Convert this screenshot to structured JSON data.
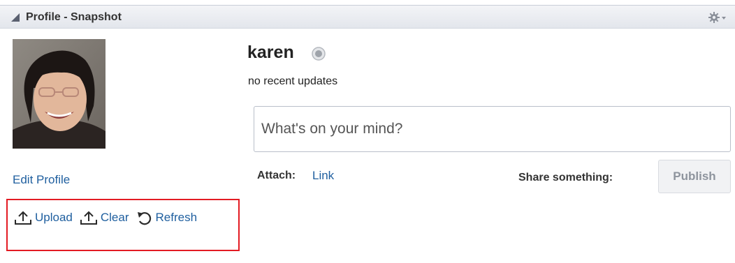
{
  "header": {
    "title": "Profile - Snapshot"
  },
  "profile": {
    "edit_label": "Edit Profile",
    "actions": [
      {
        "label": "Upload",
        "icon": "upload-icon"
      },
      {
        "label": "Clear",
        "icon": "upload-icon"
      },
      {
        "label": "Refresh",
        "icon": "refresh-icon"
      }
    ]
  },
  "user": {
    "name": "karen",
    "status": "no recent updates"
  },
  "composer": {
    "placeholder": "What's on your mind?",
    "attach_label": "Attach:",
    "attach_link": "Link",
    "share_label": "Share something:",
    "publish_label": "Publish"
  },
  "colors": {
    "link": "#1f5f9f",
    "highlight": "#e31b23",
    "header_bg": "#e8eaef"
  }
}
